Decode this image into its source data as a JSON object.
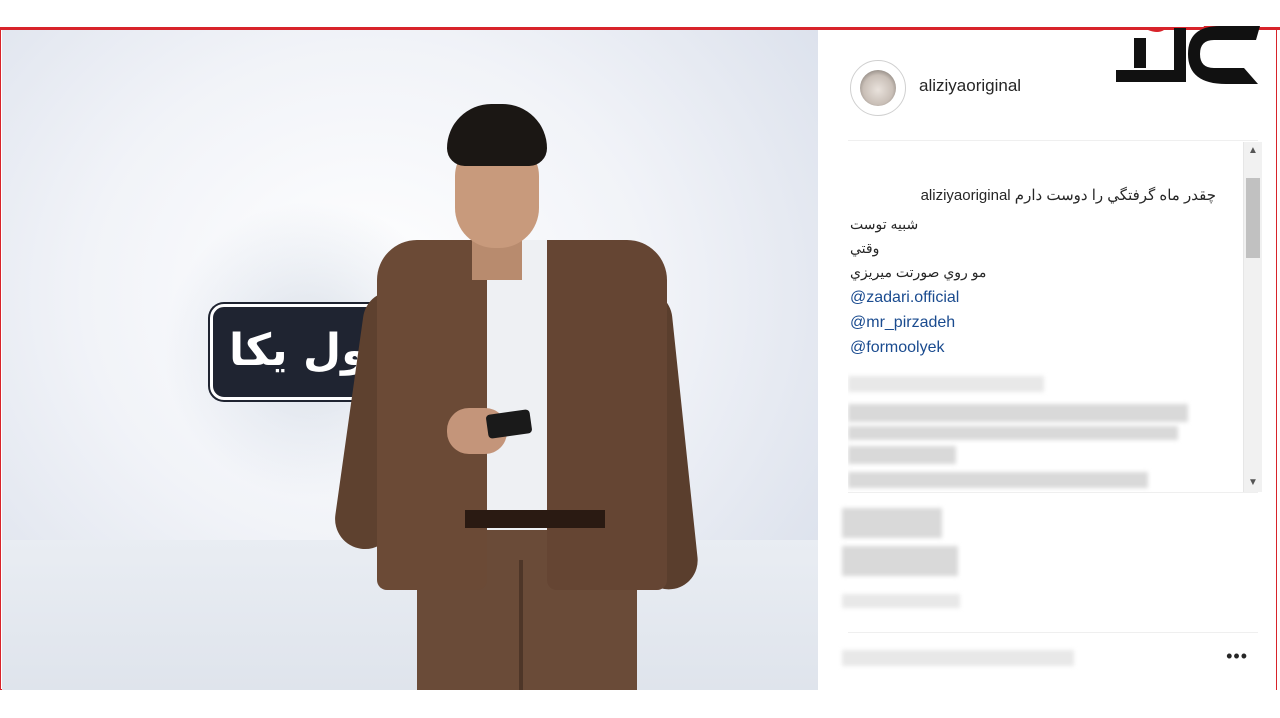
{
  "post": {
    "username": "aliziyaoriginal",
    "caption": {
      "username": "aliziyaoriginal",
      "line1": "چقدر ماه گرفتگي را دوست دارم",
      "line2": "شبيه توست",
      "line3": "وقتي",
      "line4": "مو روي صورتت ميريزي",
      "mentions": [
        "@zadari.official",
        "@mr_pirzadeh",
        "@formoolyek"
      ]
    },
    "more_icon": "•••"
  },
  "photo": {
    "logo_text": "ول یکا"
  },
  "scrollbar": {
    "up": "▲",
    "down": "▼"
  },
  "colors": {
    "accent_red": "#d8232a",
    "mention_blue": "#1a4b8f"
  }
}
